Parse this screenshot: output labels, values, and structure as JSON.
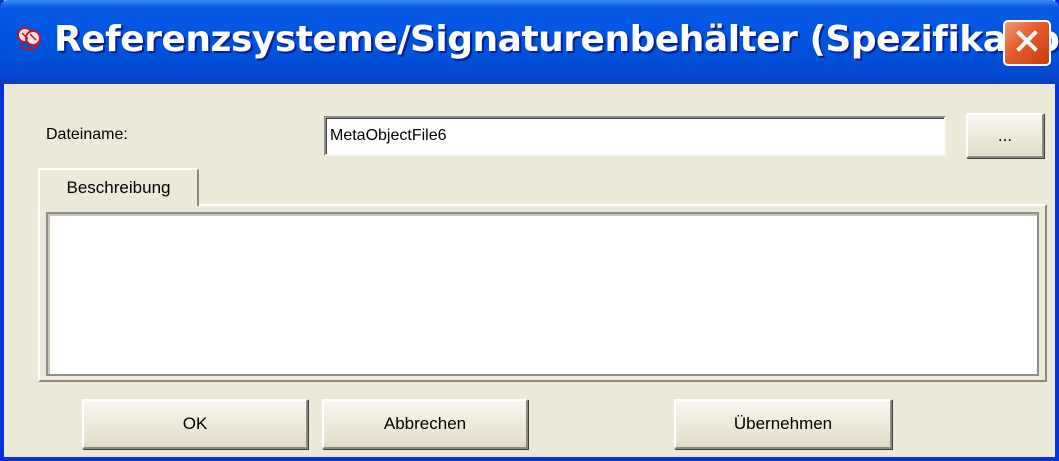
{
  "window": {
    "title": "Referenzsysteme/Signaturenbehälter (Spezifikation)",
    "close_icon": "close-icon",
    "app_icon": "app-icon",
    "accent_color": "#0054e3",
    "close_color": "#e35a2c"
  },
  "form": {
    "filename_label": "Dateiname:",
    "filename_value": "MetaObjectFile6",
    "browse_label": "..."
  },
  "tabs": [
    {
      "label": "Beschreibung"
    }
  ],
  "description": {
    "value": ""
  },
  "buttons": {
    "ok": "OK",
    "cancel": "Abbrechen",
    "apply": "Übernehmen"
  }
}
